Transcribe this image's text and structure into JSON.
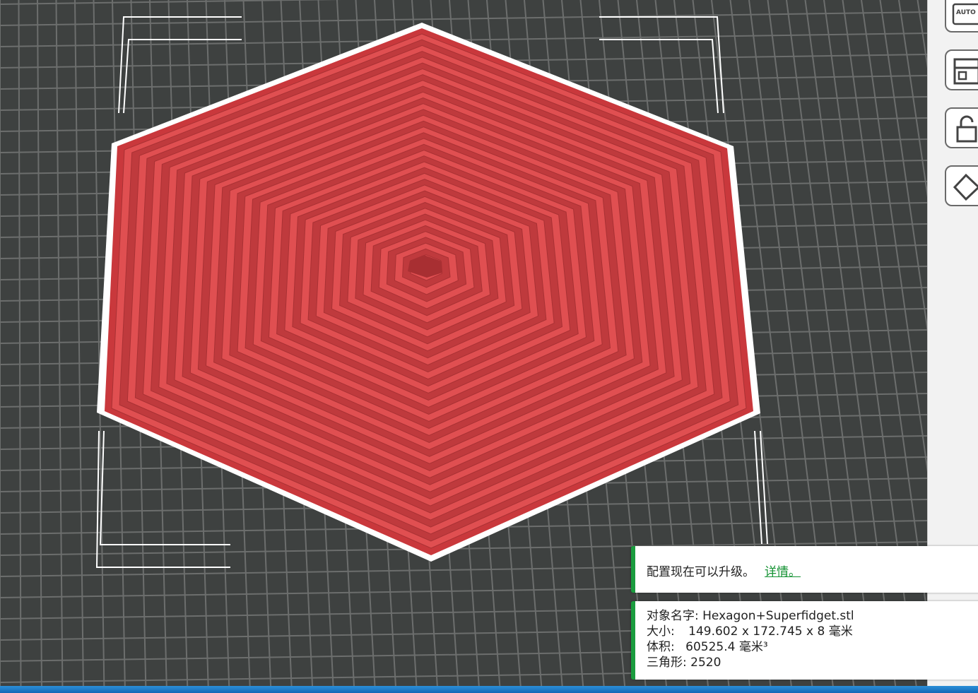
{
  "toolbar": {
    "auto_label": "AUTO",
    "icons": [
      "auto-orient-icon",
      "arrange-icon",
      "lock-icon",
      "layer-icon"
    ]
  },
  "notification": {
    "message": "配置现在可以升级。",
    "link_label": "详情。"
  },
  "object_info": {
    "name_label": "对象名字:",
    "name_value": "Hexagon+Superfidget.stl",
    "size_label": "大小:",
    "size_value": "149.602 x 172.745 x 8 毫米",
    "volume_label": "体积:",
    "volume_value": "60525.4 毫米³",
    "triangles_label": "三角形:",
    "triangles_value": "2520"
  },
  "colors": {
    "background": "#3e4140",
    "grid": "#6c6e6d",
    "model_red": "#d9474a",
    "outline": "#ffffff",
    "accent_green": "#1a9c3e"
  }
}
